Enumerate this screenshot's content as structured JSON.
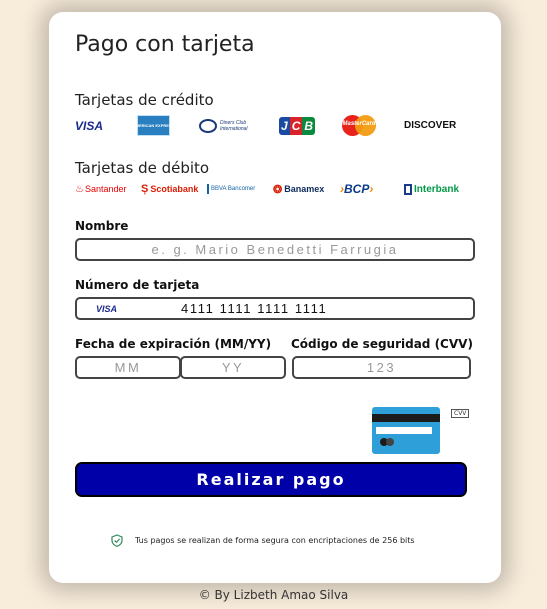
{
  "title": "Pago con tarjeta",
  "credit": {
    "label": "Tarjetas de crédito",
    "logos": [
      "VISA",
      "AMERICAN EXPRESS",
      "Diners Club International",
      "JCB",
      "MasterCard",
      "DISCOVER"
    ]
  },
  "debit": {
    "label": "Tarjetas de débito",
    "logos": [
      "Santander",
      "Scotiabank",
      "BBVA Bancomer",
      "Banamex",
      "BCP",
      "Interbank"
    ]
  },
  "form": {
    "name_label": "Nombre",
    "name_placeholder": "e. g. Mario Benedetti Farrugia",
    "card_label": "Número de tarjeta",
    "card_brand": "VISA",
    "card_value": "4111 1111 1111 1111",
    "exp_label": "Fecha de expiración (MM/YY)",
    "exp_month_placeholder": "MM",
    "exp_year_placeholder": "YY",
    "cvv_label": "Código de seguridad (CVV)",
    "cvv_placeholder": "123",
    "cvv_tag": "CVV"
  },
  "pay_button": "Realizar pago",
  "secure_note": "Tus pagos se realizan de forma segura con encriptaciones de 256 bits",
  "footer": "© By Lizbeth Amao Silva",
  "colors": {
    "accent": "#0000a8",
    "background": "#f8ecdb"
  }
}
